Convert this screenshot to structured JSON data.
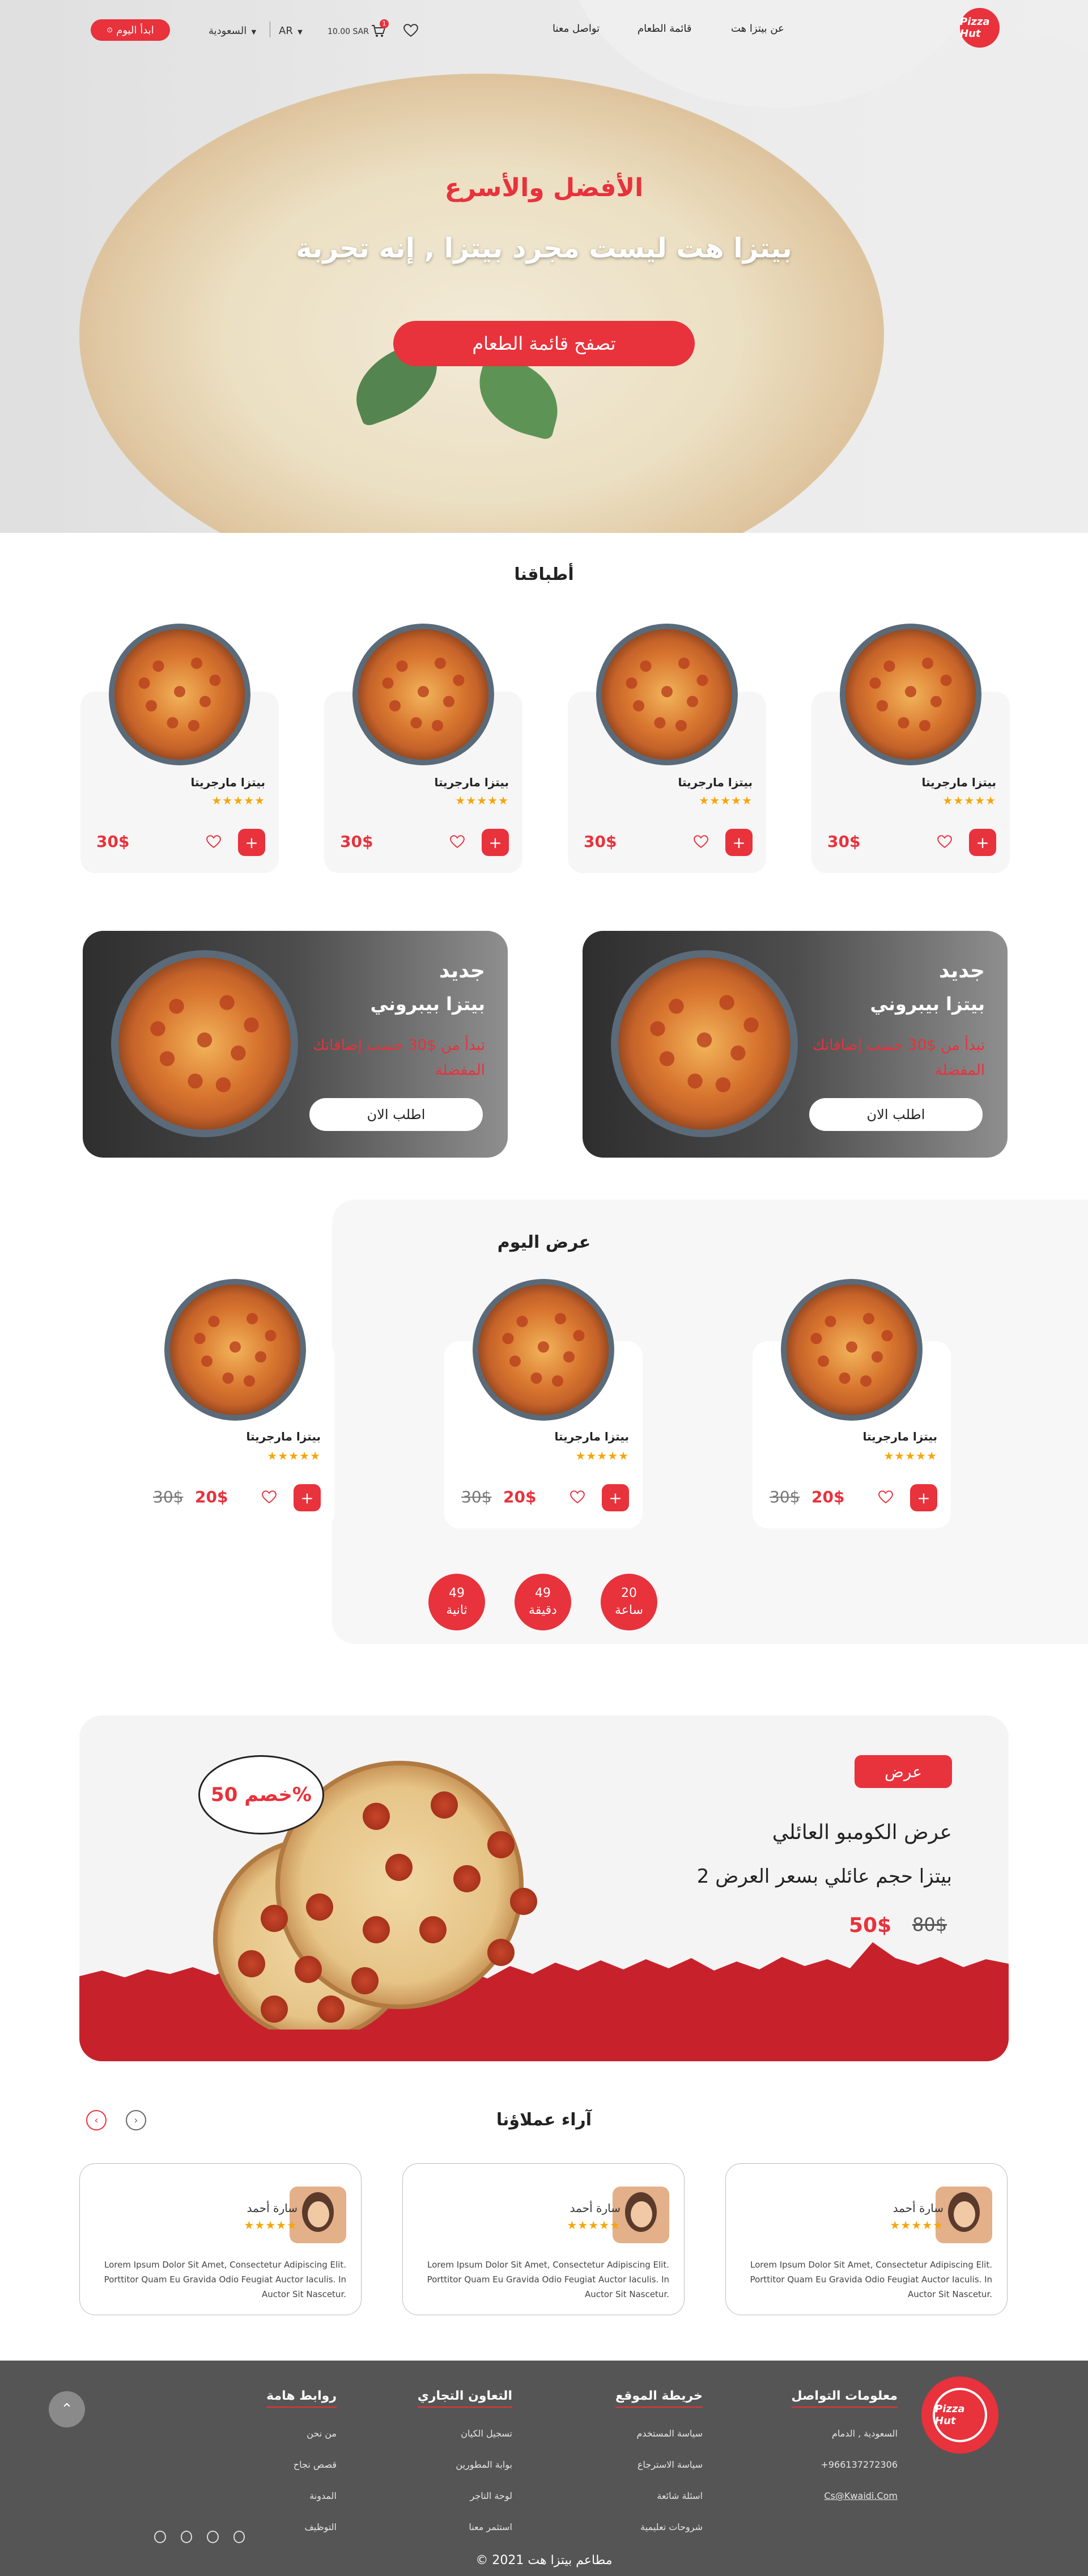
{
  "nav": {
    "logo_text": "Pizza Hut",
    "links": [
      "عن بيتزا هت",
      "قائمة الطعام",
      "تواصل معنا"
    ],
    "cart_amount": "10.00 SAR",
    "cart_count": "1",
    "lang": "AR",
    "country": "السعودية",
    "start_button": "ابدأ اليوم"
  },
  "hero": {
    "subtitle": "الأفضل والأسرع",
    "title": "بيتزا هت ليست مجرد بيتزا , إنه تجربة",
    "cta": "تصفح قائمة الطعام"
  },
  "dishes": {
    "title": "أطباقنا",
    "items": [
      {
        "name": "بيتزا مارجريتا",
        "price": "30$"
      },
      {
        "name": "بيتزا مارجريتا",
        "price": "30$"
      },
      {
        "name": "بيتزا مارجريتا",
        "price": "30$"
      },
      {
        "name": "بيتزا مارجريتا",
        "price": "30$"
      }
    ],
    "stars": "★★★★★"
  },
  "promos": [
    {
      "badge": "جديد",
      "name": "بيتزا بيبروني",
      "desc": "تبدأ من $30 حسب إضافاتك المفضلة",
      "button": "اطلب الان"
    },
    {
      "badge": "جديد",
      "name": "بيتزا بيبروني",
      "desc": "تبدأ من $30 حسب إضافاتك المفضلة",
      "button": "اطلب الان"
    }
  ],
  "today": {
    "title": "عرض اليوم",
    "items": [
      {
        "name": "بيتزا مارجريتا",
        "price": "20$",
        "old_price": "30$"
      },
      {
        "name": "بيتزا مارجريتا",
        "price": "20$",
        "old_price": "30$"
      },
      {
        "name": "بيتزا مارجريتا",
        "price": "20$",
        "old_price": "30$"
      }
    ],
    "timer": [
      {
        "value": "20",
        "unit": "ساعة"
      },
      {
        "value": "49",
        "unit": "دقيقة"
      },
      {
        "value": "49",
        "unit": "ثانية"
      }
    ]
  },
  "combo": {
    "badge": "عرض",
    "title": "عرض الكومبو العائلي",
    "desc": "2 بيتزا حجم عائلي بسعر العرض",
    "price": "50$",
    "old_price": "80$",
    "bubble": "خصم 50%"
  },
  "reviews": {
    "title": "آراء عملاؤنا",
    "items": [
      {
        "name": "سارة أحمد",
        "text": "Lorem Ipsum Dolor Sit Amet, Consectetur Adipiscing Elit. Porttitor Quam Eu Gravida Odio Feugiat Auctor Iaculis. In Auctor Sit Nascetur."
      },
      {
        "name": "سارة أحمد",
        "text": "Lorem Ipsum Dolor Sit Amet, Consectetur Adipiscing Elit. Porttitor Quam Eu Gravida Odio Feugiat Auctor Iaculis. In Auctor Sit Nascetur."
      },
      {
        "name": "سارة أحمد",
        "text": "Lorem Ipsum Dolor Sit Amet, Consectetur Adipiscing Elit. Porttitor Quam Eu Gravida Odio Feugiat Auctor Iaculis. In Auctor Sit Nascetur."
      }
    ]
  },
  "footer": {
    "cols": [
      {
        "title": "روابط هامة",
        "items": [
          "من نحن",
          "قصص نجاح",
          "المدونة",
          "التوظيف"
        ]
      },
      {
        "title": "التعاون التجاري",
        "items": [
          "تسجيل الكيان",
          "بوابة المطورين",
          "لوحة التاجر",
          "استثمر معنا"
        ]
      },
      {
        "title": "خريطة الموقع",
        "items": [
          "سياسة المستخدم",
          "سياسة الاسترجاع",
          "اسئلة شائعة",
          "شروحات تعليمية"
        ]
      },
      {
        "title": "معلومات التواصل",
        "items": [
          "السعودية , الدمام",
          "+966137272306",
          "Cs@Kwaidi.Com"
        ]
      }
    ],
    "copyright": "© 2021 مطاعم بيتزا هت"
  },
  "colors": {
    "brand": "#e8323c",
    "footer": "#555555",
    "star": "#f6a609"
  }
}
